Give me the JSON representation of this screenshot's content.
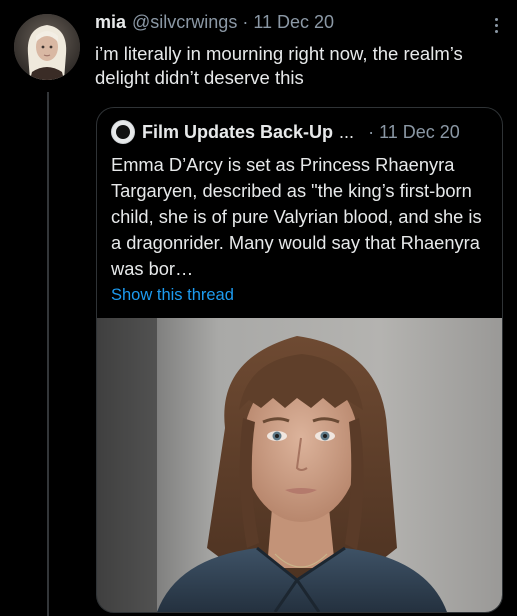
{
  "tweet": {
    "author": {
      "display_name": "mia",
      "handle": "@silvcrwings",
      "avatar_icon": "profile-avatar-icon"
    },
    "separator": "·",
    "date": "11 Dec 20",
    "text": "i’m literally in mourning right now, the realm’s delight didn’t deserve this",
    "more_icon": "more-options-icon"
  },
  "quoted_tweet": {
    "author": {
      "display_name": "Film Updates Back-Up",
      "truncation": "...",
      "avatar_icon": "film-updates-avatar-icon"
    },
    "separator": "·",
    "date": "11 Dec 20",
    "text": "Emma D’Arcy is set as Princess Rhaenyra Targaryen, described as \"the king’s first-born child, she is of pure Valyrian blood, and she is a dragonrider. Many would say that Rhaenyra was bor…",
    "show_thread_label": "Show this thread",
    "link_color": "#1d9bf0"
  },
  "colors": {
    "background": "#000000",
    "primary_text": "#e7e9ea",
    "secondary_text": "#8b98a5",
    "border": "#2f3336"
  }
}
